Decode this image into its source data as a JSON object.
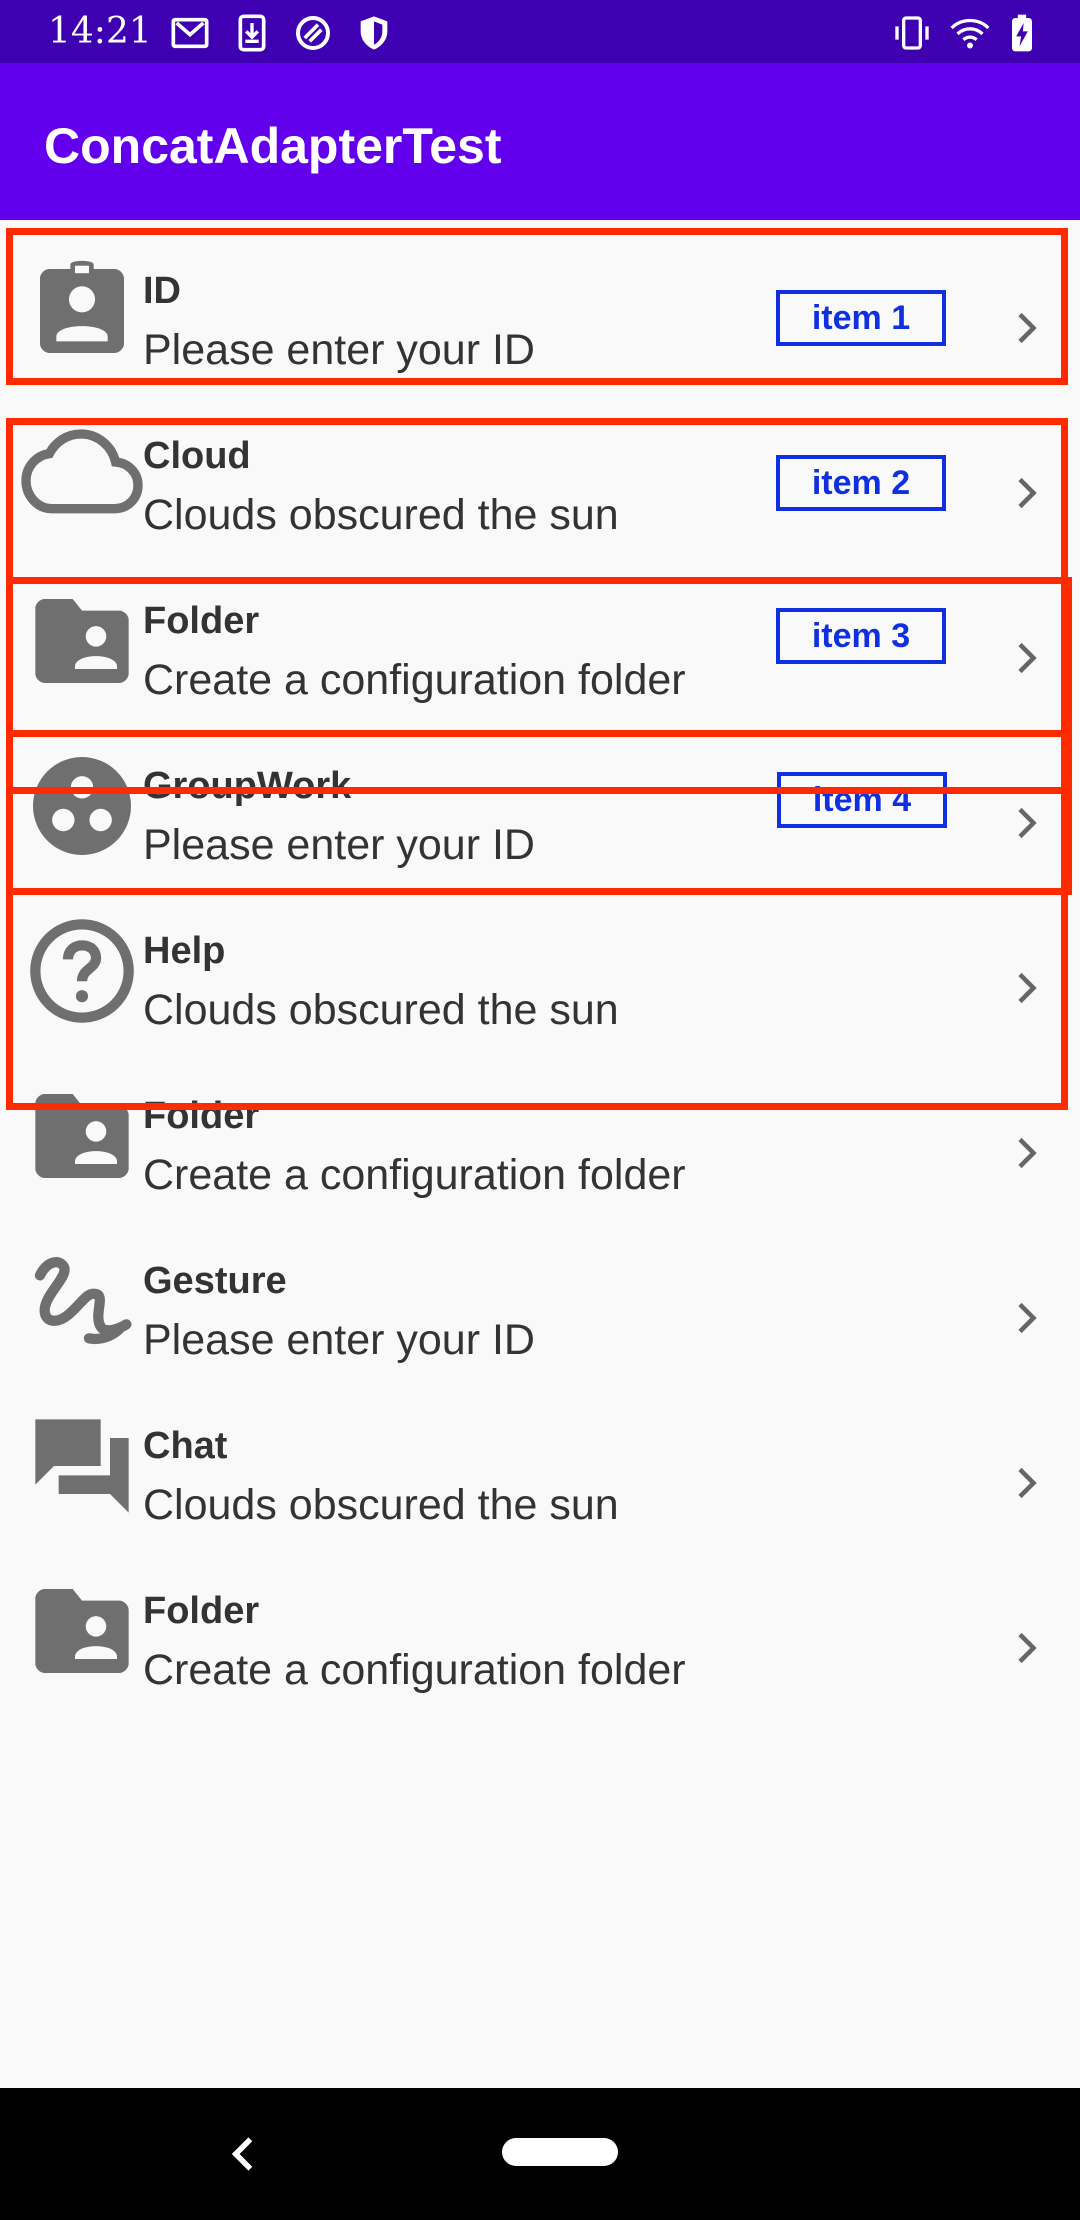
{
  "status_bar": {
    "time": "14:21",
    "left_icons": [
      "gmail-icon",
      "download-icon",
      "vpn-icon",
      "shield-icon"
    ],
    "right_icons": [
      "vibrate-icon",
      "wifi-icon",
      "battery-charging-icon"
    ]
  },
  "app_bar": {
    "title": "ConcatAdapterTest",
    "color": "#6200ee"
  },
  "list": {
    "items": [
      {
        "icon": "badge-icon",
        "title": "ID",
        "subtitle": "Please enter your ID",
        "badge": "item 1"
      },
      {
        "icon": "cloud-icon",
        "title": "Cloud",
        "subtitle": "Clouds obscured the sun",
        "badge": "item 2"
      },
      {
        "icon": "folder-shared-icon",
        "title": "Folder",
        "subtitle": "Create a configuration folder",
        "badge": "item 3"
      },
      {
        "icon": "group-work-icon",
        "title": "GroupWork",
        "subtitle": "Please enter your ID",
        "badge": "item 4"
      },
      {
        "icon": "help-icon",
        "title": "Help",
        "subtitle": "Clouds obscured the sun"
      },
      {
        "icon": "folder-shared-icon",
        "title": "Folder",
        "subtitle": "Create a configuration folder"
      },
      {
        "icon": "gesture-icon",
        "title": "Gesture",
        "subtitle": "Please enter your ID"
      },
      {
        "icon": "chat-icon",
        "title": "Chat",
        "subtitle": "Clouds obscured the sun"
      },
      {
        "icon": "folder-shared-icon",
        "title": "Folder",
        "subtitle": "Create a configuration folder"
      }
    ]
  },
  "highlight_color": "#ff2a00",
  "badge_color": "#1030e0",
  "nav_bar": {
    "icons": [
      "back-icon",
      "home-pill"
    ]
  }
}
